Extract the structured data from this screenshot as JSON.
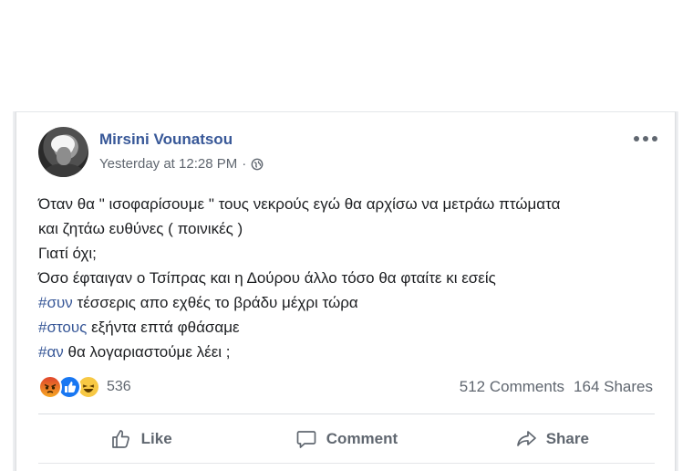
{
  "post": {
    "author": "Mirsini Vounatsou",
    "timestamp": "Yesterday at 12:28 PM",
    "separator": "·",
    "privacy_icon": "globe-icon",
    "more_icon": "more-options-icon",
    "text": {
      "line1": "Όταν θα \" ισοφαρίσουμε \" τους νεκρούς εγώ θα αρχίσω να μετράω πτώματα",
      "line2": "και ζητάω ευθύνες ( ποινικές )",
      "line3": "Γιατί όχι;",
      "line4": "Όσο έφταιγαν ο Τσίπρας και η Δούρου άλλο τόσο θα φταίτε κι εσείς",
      "line5_tag": "#συν",
      "line5_rest": " τέσσερις απο εχθές το βράδυ μέχρι τώρα",
      "line6_tag": "#στους",
      "line6_rest": " εξήντα επτά φθάσαμε",
      "line7_tag": "#αν",
      "line7_rest": " θα λογαριαστούμε λέει ;"
    }
  },
  "reactions": {
    "icons": [
      "angry-icon",
      "like-icon",
      "haha-icon"
    ],
    "count": "536"
  },
  "stats": {
    "comments": "512 Comments",
    "shares": "164 Shares"
  },
  "actions": {
    "like_label": "Like",
    "comment_label": "Comment",
    "share_label": "Share"
  },
  "colors": {
    "author_blue": "#385898",
    "hashtag_blue": "#385898",
    "secondary_text": "#606770",
    "body_text": "#1c1e21"
  }
}
